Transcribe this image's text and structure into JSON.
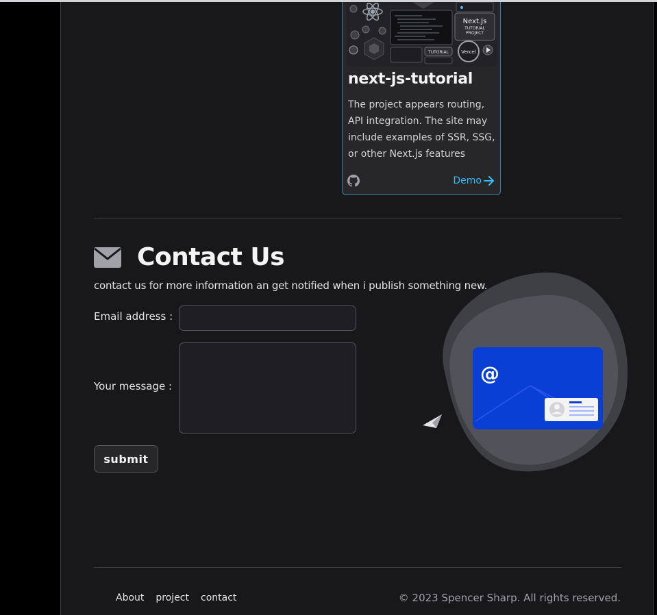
{
  "project": {
    "image_texts": {
      "next_logo_line1": "Next.Js",
      "next_logo_line2": "TUTORIAL",
      "next_logo_line3": "PROJECT",
      "tutorial_label": "TUTORIAL",
      "vercel_label": "Vercel"
    },
    "title": "next-js-tutorial",
    "description": "The project appears routing, API integration. The site may include examples of SSR, SSG, or other Next.js features",
    "demo_label": "Demo",
    "icons": {
      "repo": "github-icon",
      "demo": "arrow-right-icon"
    }
  },
  "contact": {
    "title": "Contact Us",
    "subtitle": "contact us for more information an get notified when i publish something new.",
    "email_label": "Email address :",
    "email_value": "",
    "message_label": "Your message :",
    "message_value": "",
    "submit_label": "submit",
    "illustration": {
      "at_symbol": "@"
    },
    "icons": {
      "heading": "envelope-icon"
    }
  },
  "footer": {
    "nav": [
      "About",
      "project",
      "contact"
    ],
    "copyright": "© 2023 Spencer Sharp. All rights reserved."
  },
  "colors": {
    "background": "#18181b",
    "accent_link": "#38bdf8",
    "card_border": "#3b82a6",
    "envelope_blue": "#0a3fd6"
  }
}
